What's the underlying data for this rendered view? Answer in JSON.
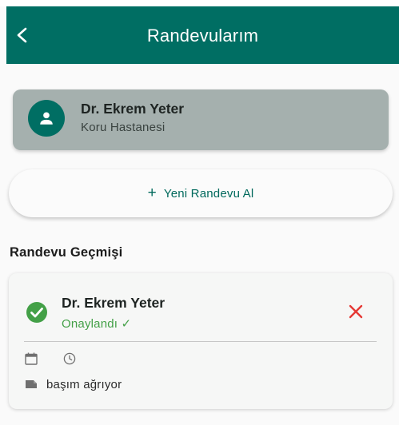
{
  "appbar": {
    "title": "Randevularım",
    "back_icon": "arrow-back-icon"
  },
  "doctor": {
    "name": "Dr. Ekrem Yeter",
    "hospital": "Koru Hastanesi",
    "avatar_icon": "person-icon"
  },
  "new_appointment": {
    "icon": "plus-icon",
    "label": "Yeni Randevu Al"
  },
  "history": {
    "title": "Randevu Geçmişi",
    "items": [
      {
        "doctor": "Dr. Ekrem Yeter",
        "status": "Onaylandı ✓",
        "status_icon": "check-circle-icon",
        "date": "",
        "time": "",
        "note": "başım ağrıyor",
        "cancel_icon": "close-icon"
      }
    ]
  },
  "colors": {
    "primary": "#006e63",
    "card_bg": "#a5b0ae",
    "approved": "#43a047",
    "cancel": "#e53935"
  }
}
